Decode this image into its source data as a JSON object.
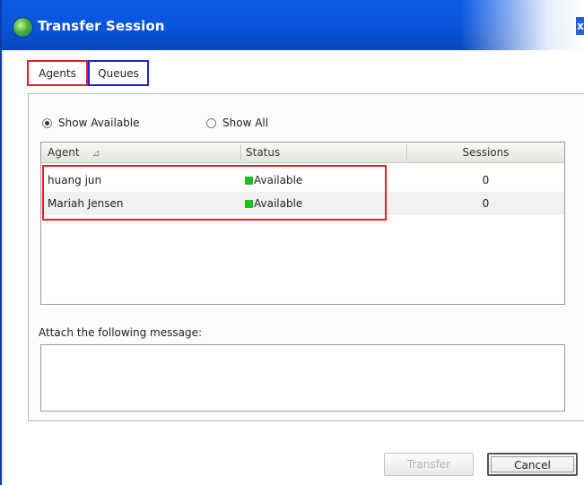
{
  "window": {
    "title": "Transfer Session",
    "close_symbol": "x"
  },
  "tabs": [
    {
      "label": "Agents"
    },
    {
      "label": "Queues"
    }
  ],
  "filter": {
    "show_available_label": "Show Available",
    "show_all_label": "Show All",
    "selected": "Show Available"
  },
  "list": {
    "columns": [
      "Agent",
      "Status",
      "Sessions"
    ],
    "sort_indicator": "⊿",
    "rows": [
      {
        "agent": "huang jun",
        "status": "Available",
        "sessions": "0"
      },
      {
        "agent": "Mariah Jensen",
        "status": "Available",
        "sessions": "0"
      }
    ]
  },
  "message": {
    "label": "Attach the following message:",
    "value": ""
  },
  "buttons": {
    "transfer_label": "Transfer",
    "cancel_label": "Cancel"
  },
  "colors": {
    "status_available": "#1fbe1f",
    "highlight_red": "#e32121",
    "highlight_blue": "#1e22dd",
    "titlebar": "#0a54d8"
  }
}
